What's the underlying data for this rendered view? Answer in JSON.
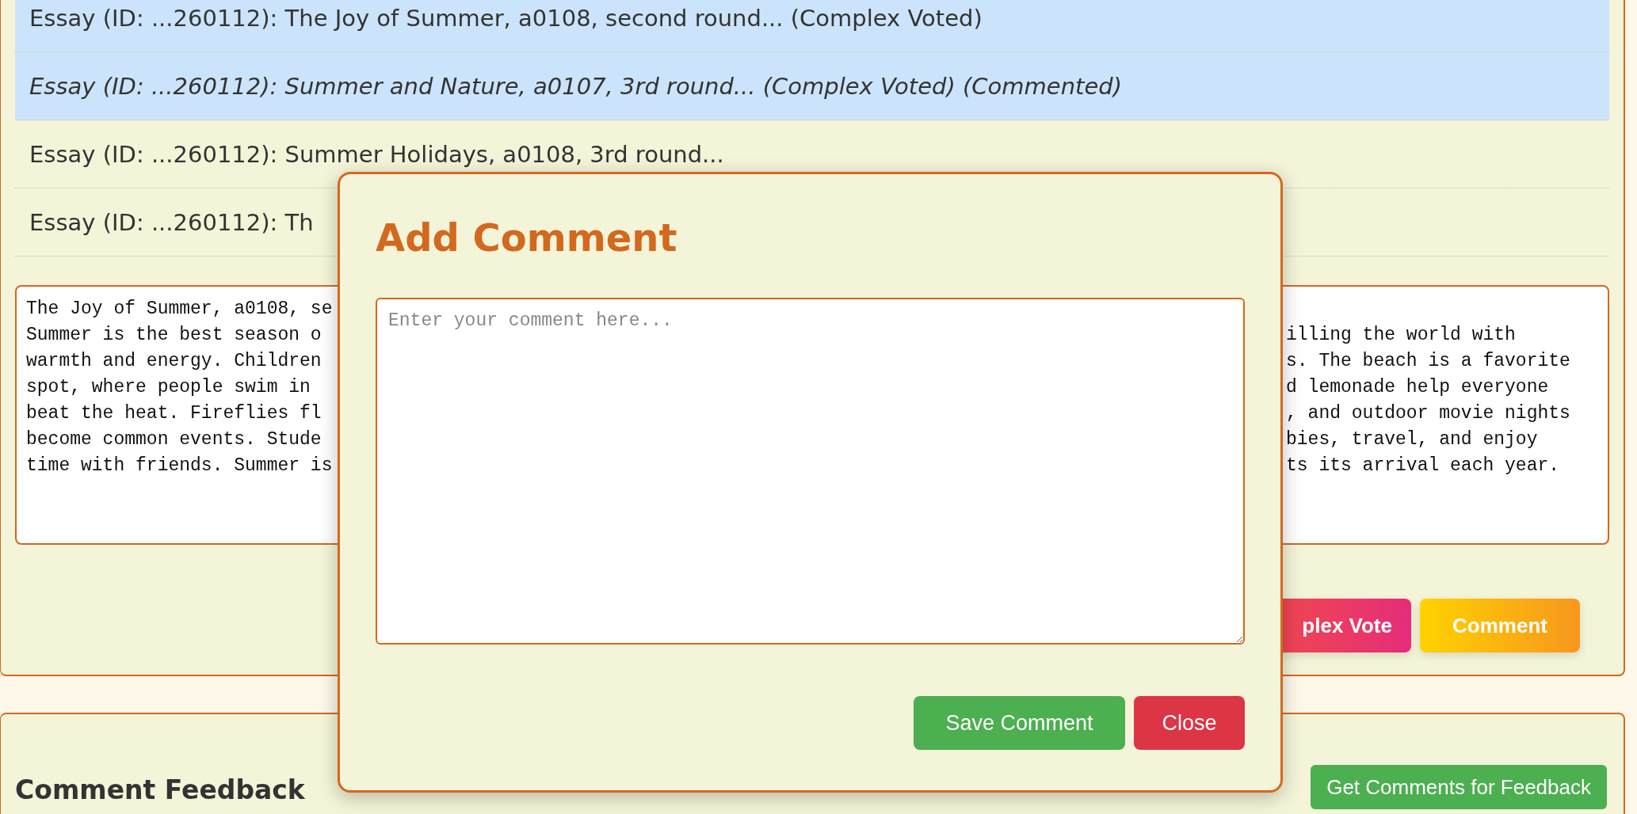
{
  "essay_list": [
    {
      "label": "Essay (ID: ...260112): The Joy of Summer, a0108, second round... (Complex Voted)",
      "selected": true,
      "commented": false
    },
    {
      "label": "Essay (ID: ...260112): Summer and Nature, a0107, 3rd round... (Complex Voted) (Commented)",
      "selected": true,
      "commented": true
    },
    {
      "label": "Essay (ID: ...260112): Summer Holidays, a0108, 3rd round...",
      "selected": false,
      "commented": false
    },
    {
      "label": "Essay (ID: ...260112): Th",
      "selected": false,
      "commented": false
    }
  ],
  "essay_text": [
    {
      "left": "The Joy of Summer, a0108, se"
    },
    {
      "left": "Summer is the best season o",
      "right": "illing the world with"
    },
    {
      "left": "warmth and energy. Children",
      "right": "s. The beach is a favorite"
    },
    {
      "left": "spot, where people swim in",
      "right": "d lemonade help everyone"
    },
    {
      "left": "beat the heat. Fireflies fl",
      "right": ", and outdoor movie nights"
    },
    {
      "left": "become common events. Stude",
      "right": "bies, travel, and enjoy"
    },
    {
      "left": "time with friends. Summer is",
      "right": "ts its arrival each year."
    }
  ],
  "actions": [
    {
      "label": "plex Vote",
      "kind": "vote"
    },
    {
      "label": "Comment",
      "kind": "comment"
    }
  ],
  "feedback": {
    "title": "Comment Feedback",
    "button": "Get Comments for Feedback"
  },
  "modal": {
    "title": "Add Comment",
    "placeholder": "Enter your comment here...",
    "buttons": [
      {
        "label": "Save Comment",
        "kind": "save"
      },
      {
        "label": "Close",
        "kind": "close"
      }
    ]
  }
}
